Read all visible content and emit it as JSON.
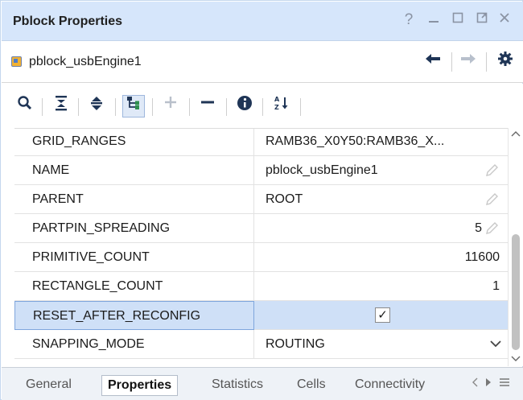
{
  "window": {
    "title": "Pblock Properties",
    "help": "?",
    "controls": [
      "minimize-icon",
      "maximize-icon",
      "float-icon",
      "close-icon"
    ]
  },
  "object": {
    "name": "pblock_usbEngine1",
    "icon": "pblock-icon"
  },
  "toolbar": {
    "buttons": [
      "search-icon",
      "collapse-all-icon",
      "expand-all-icon",
      "group-icon",
      "add-icon",
      "remove-icon",
      "info-icon",
      "sort-az-icon"
    ]
  },
  "properties": [
    {
      "name": "GRID_RANGES",
      "value": "RAMB36_X0Y50:RAMB36_X..."
    },
    {
      "name": "NAME",
      "value": "pblock_usbEngine1"
    },
    {
      "name": "PARENT",
      "value": "ROOT"
    },
    {
      "name": "PARTPIN_SPREADING",
      "value": "5"
    },
    {
      "name": "PRIMITIVE_COUNT",
      "value": "11600"
    },
    {
      "name": "RECTANGLE_COUNT",
      "value": "1"
    },
    {
      "name": "RESET_AFTER_RECONFIG",
      "value": "✓"
    },
    {
      "name": "SNAPPING_MODE",
      "value": "ROUTING"
    }
  ],
  "tabs": [
    {
      "label": "General"
    },
    {
      "label": "Properties"
    },
    {
      "label": "Statistics"
    },
    {
      "label": "Cells"
    },
    {
      "label": "Connectivity"
    }
  ],
  "colors": {
    "titlebar": "#d6e6fb",
    "selection": "#cfe0f7",
    "icon": "#2a3e5c"
  }
}
